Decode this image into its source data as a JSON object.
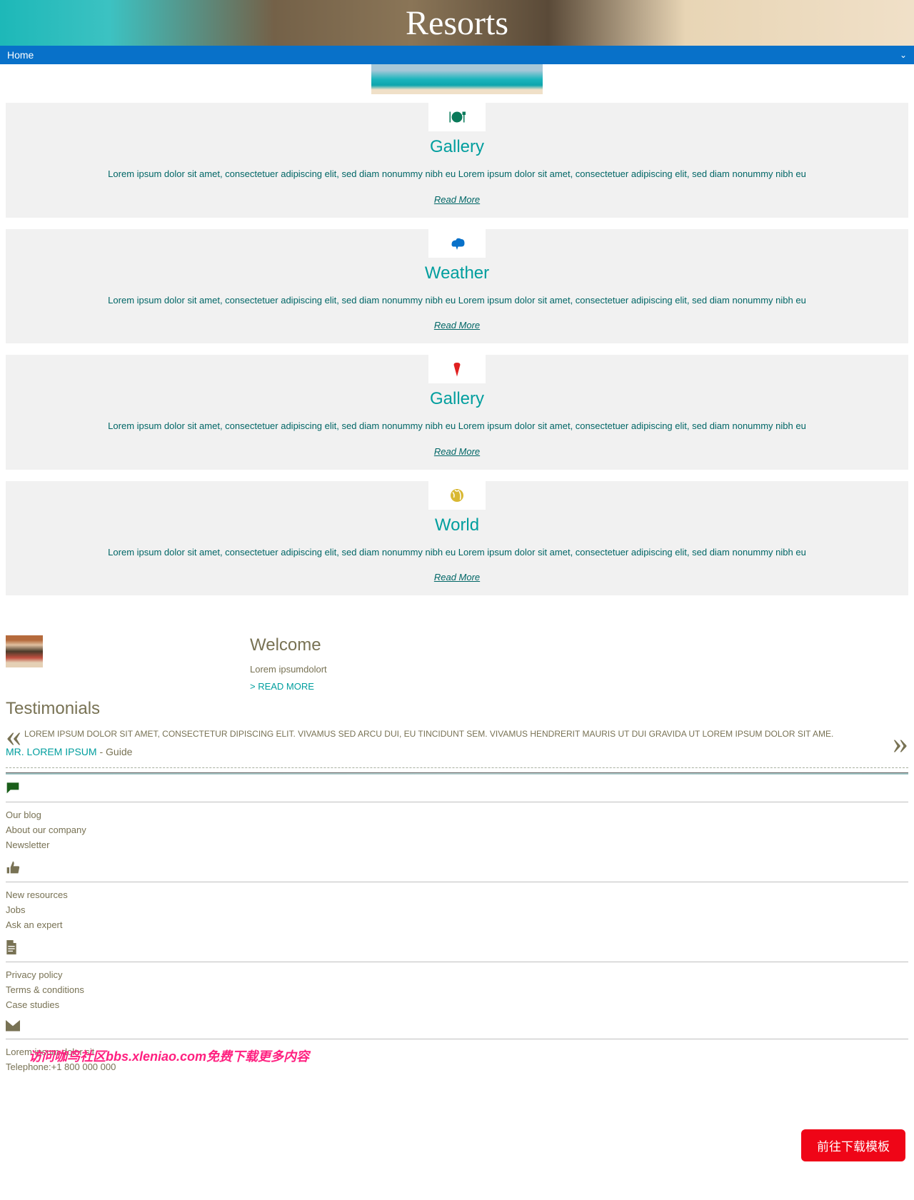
{
  "logo": "Resorts",
  "nav": {
    "home": "Home"
  },
  "cards": [
    {
      "title": "Gallery",
      "desc": "Lorem ipsum dolor sit amet, consectetuer adipiscing elit, sed diam nonummy nibh eu Lorem ipsum dolor sit amet, consectetuer adipiscing elit, sed diam nonummy nibh eu",
      "link": "Read More"
    },
    {
      "title": "Weather",
      "desc": "Lorem ipsum dolor sit amet, consectetuer adipiscing elit, sed diam nonummy nibh eu Lorem ipsum dolor sit amet, consectetuer adipiscing elit, sed diam nonummy nibh eu",
      "link": "Read More"
    },
    {
      "title": "Gallery",
      "desc": "Lorem ipsum dolor sit amet, consectetuer adipiscing elit, sed diam nonummy nibh eu Lorem ipsum dolor sit amet, consectetuer adipiscing elit, sed diam nonummy nibh eu",
      "link": "Read More"
    },
    {
      "title": "World",
      "desc": "Lorem ipsum dolor sit amet, consectetuer adipiscing elit, sed diam nonummy nibh eu Lorem ipsum dolor sit amet, consectetuer adipiscing elit, sed diam nonummy nibh eu",
      "link": "Read More"
    }
  ],
  "welcome": {
    "title": "Welcome",
    "text": "Lorem ipsumdolort",
    "link": "> READ MORE"
  },
  "testimonials": {
    "title": "Testimonials",
    "quote": "LOREM IPSUM DOLOR SIT AMET, CONSECTETUR DIPISCING ELIT. VIVAMUS SED ARCU DUI, EU TINCIDUNT SEM. VIVAMUS HENDRERIT MAURIS UT DUI GRAVIDA UT LOREM IPSUM DOLOR SIT AME.",
    "author": "MR. LOREM IPSUM",
    "sep": " - ",
    "role": "Guide"
  },
  "footer": {
    "col1": [
      "Our blog",
      "About our company",
      "Newsletter"
    ],
    "col2": [
      "New resources",
      "Jobs",
      "Ask an expert"
    ],
    "col3": [
      "Privacy policy",
      "Terms & conditions",
      "Case studies"
    ],
    "contact": {
      "line1": "Lorem ipsum dolor sit,",
      "line2": "Telephone:+1 800 000 000"
    }
  },
  "watermark": "访问咖鸟社区bbs.xleniao.com免费下载更多内容",
  "download_btn": "前往下载模板"
}
